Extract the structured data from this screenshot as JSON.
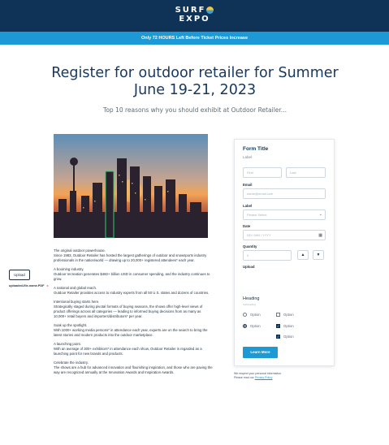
{
  "header": {
    "logo_line1": "SURF",
    "logo_line2": "EXPO",
    "banner": "Only 72 HOURS Left Before Ticket Prices Increase"
  },
  "hero": {
    "title_line1": "Register for outdoor retailer for Summer",
    "title_line2": "June 19-21, 2023",
    "subtitle": "Top 10 reasons why you should exhibit at Outdoor Retailer..."
  },
  "reasons": [
    {
      "heading": "The original outdoor powerhouse.",
      "body": "Since 1983, Outdoor Retailer has hosted the largest gatherings of outdoor and snowsports industry professionals in the nation/world — drawing up to 20,000+ registered attendees* each year."
    },
    {
      "heading": "A booming industry.",
      "body": "Outdoor recreation generates $460+ billion USD in consumer spending, and the industry continues to grow."
    },
    {
      "heading": "A national and global reach.",
      "body": "Outdoor Retailer provides access to industry experts from all 50 U.S. states and dozens of countries."
    },
    {
      "heading": "Intentional buying starts here.",
      "body": "Strategically staged during pivotal formats of buying seasons, the shows offer high-level views of product offerings across all categories — leading to informed buying decisions from as many as 10,000+ retail buyers and importers/distributors* per year."
    },
    {
      "heading": "Soak up the spotlight.",
      "body": "With 1000+ working media persons* in attendance each year, experts are on the search to bring the latest stories and modern products into the outdoor marketplace."
    },
    {
      "heading": "A launching point.",
      "body": "With an average of 300+ exhibitors* in attendance each show, Outdoor Retailer is regarded as a launching point for new brands and products."
    },
    {
      "heading": "Celebrate the industry.",
      "body": "The shows are a hub for advanced innovation and flourishing inspiration, and those who are paving the way are recognized annually at the Innovation Awards and Inspiration Awards."
    }
  ],
  "form": {
    "title": "Form Title",
    "description": "Label",
    "first_placeholder": "First",
    "last_placeholder": "Last",
    "email_label": "Email",
    "email_placeholder": "name@email.com",
    "select_label": "Label",
    "select_placeholder": "Please Select",
    "date_label": "Date",
    "date_placeholder": "DD / MM / YYYY",
    "quantity_label": "Quantity",
    "quantity_value": "0",
    "upload_label": "Upload",
    "upload_button": "Upload",
    "file_name": "uploaded-file-name.PDF",
    "file_remove": "x",
    "heading": "Heading",
    "heading_sub": "Subheading",
    "radio_options": [
      {
        "label": "Option",
        "checked": false
      },
      {
        "label": "Option",
        "checked": true
      }
    ],
    "check_options": [
      {
        "label": "Option",
        "checked": false
      },
      {
        "label": "Option",
        "checked": true
      },
      {
        "label": "Option",
        "checked": true
      }
    ],
    "submit": "Learn More",
    "privacy_line1": "We respect your personal information.",
    "privacy_line2": "Please read our",
    "privacy_link": "Privacy Policy"
  },
  "colors": {
    "navy": "#0f3357",
    "accent": "#1d9ad6"
  }
}
